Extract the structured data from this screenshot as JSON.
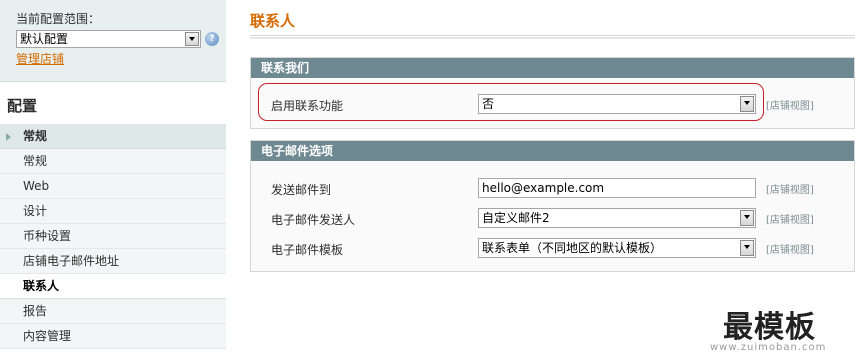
{
  "sidebar": {
    "scope_label": "当前配置范围：",
    "scope_value": "默认配置",
    "manage_stores_link": "管理店铺",
    "config_heading": "配置",
    "nav_items": [
      {
        "label": "常规",
        "kind": "group"
      },
      {
        "label": "常规",
        "kind": "sub"
      },
      {
        "label": "Web",
        "kind": "sub"
      },
      {
        "label": "设计",
        "kind": "sub"
      },
      {
        "label": "币种设置",
        "kind": "sub"
      },
      {
        "label": "店铺电子邮件地址",
        "kind": "sub"
      },
      {
        "label": "联系人",
        "kind": "active"
      },
      {
        "label": "报告",
        "kind": "sub"
      },
      {
        "label": "内容管理",
        "kind": "sub"
      }
    ]
  },
  "main": {
    "page_title": "联系人",
    "contact_us": {
      "heading": "联系我们",
      "enable_label": "启用联系功能",
      "enable_value": "否",
      "scope_hint": "[店铺视图]"
    },
    "email_options": {
      "heading": "电子邮件选项",
      "send_to_label": "发送邮件到",
      "send_to_value": "hello@example.com",
      "sender_label": "电子邮件发送人",
      "sender_value": "自定义邮件2",
      "template_label": "电子邮件模板",
      "template_value": "联系表单（不同地区的默认模板）",
      "scope_hint": "[店铺视图]"
    }
  },
  "watermark": {
    "text": "最模板",
    "url": "www.zuimoban.com"
  },
  "colors": {
    "accent": "#d46a00",
    "section_header": "#6f8992",
    "highlight": "#c8202b"
  }
}
